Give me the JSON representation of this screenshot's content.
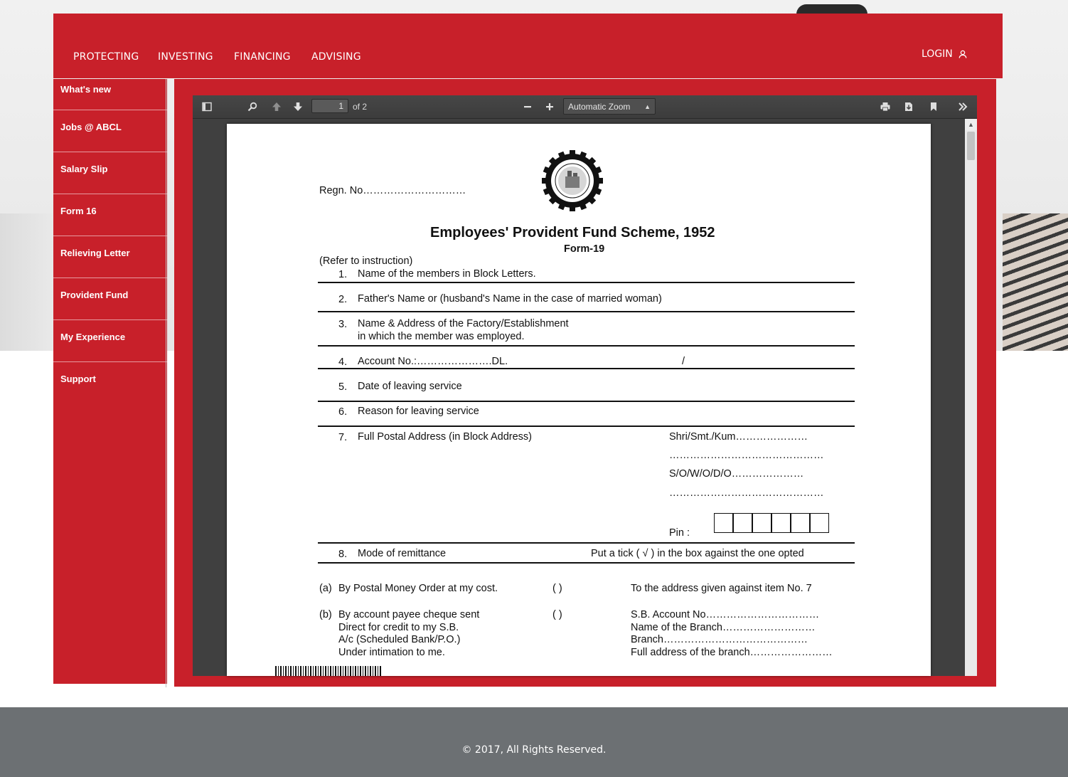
{
  "nav": {
    "items": [
      "PROTECTING",
      "INVESTING",
      "FINANCING",
      "ADVISING"
    ],
    "login": "LOGIN"
  },
  "sidebar": {
    "items": [
      "What's new",
      "Jobs @ ABCL",
      "Salary Slip",
      "Form 16",
      "Relieving Letter",
      "Provident Fund",
      "My Experience",
      "Support"
    ]
  },
  "viewer": {
    "page_number": "1",
    "page_count": "of 2",
    "zoom": "Automatic Zoom"
  },
  "form": {
    "regn": "Regn. No…………………………",
    "title": "Employees' Provident Fund Scheme, 1952",
    "subtitle": "Form-19",
    "refer": "(Refer to instruction)",
    "rows": [
      {
        "num": "1.",
        "text": "Name of the members in Block Letters."
      },
      {
        "num": "2.",
        "text": "Father's Name or (husband's Name in the case of married woman)"
      },
      {
        "num": "3.",
        "text": "Name & Address of the Factory/Establishment",
        "text2": "in which the member was employed."
      },
      {
        "num": "4.",
        "text": "Account No.:………………….DL.",
        "extra": "/"
      },
      {
        "num": "5.",
        "text": "Date of leaving service"
      },
      {
        "num": "6.",
        "text": "Reason for leaving service"
      },
      {
        "num": "7.",
        "text": "Full Postal Address (in Block Address)"
      },
      {
        "num": "8.",
        "text": "Mode of remittance",
        "extra": "Put a tick ( √ ) in the box against the one opted"
      }
    ],
    "address_lines": [
      "Shri/Smt./Kum…………………",
      "………………………………………",
      "S/O/W/O/D/O…………………",
      "………………………………………"
    ],
    "pin_label": "Pin  :",
    "option_a": {
      "label": "(a)",
      "text": "By Postal Money Order  at my cost.",
      "box": "(      )",
      "right": "To the address given against item No. 7"
    },
    "option_b": {
      "label": "(b)",
      "lines": [
        "By account payee cheque sent",
        "Direct for credit to my S.B.",
        "A/c (Scheduled Bank/P.O.)",
        "Under intimation to me."
      ],
      "box": "(      )",
      "right": [
        "S.B. Account No……………………………",
        "Name of the Branch………………………",
        "Branch……………………………………",
        "Full address of the branch……………………"
      ]
    }
  },
  "footer": {
    "text": "© 2017, All Rights Reserved."
  }
}
